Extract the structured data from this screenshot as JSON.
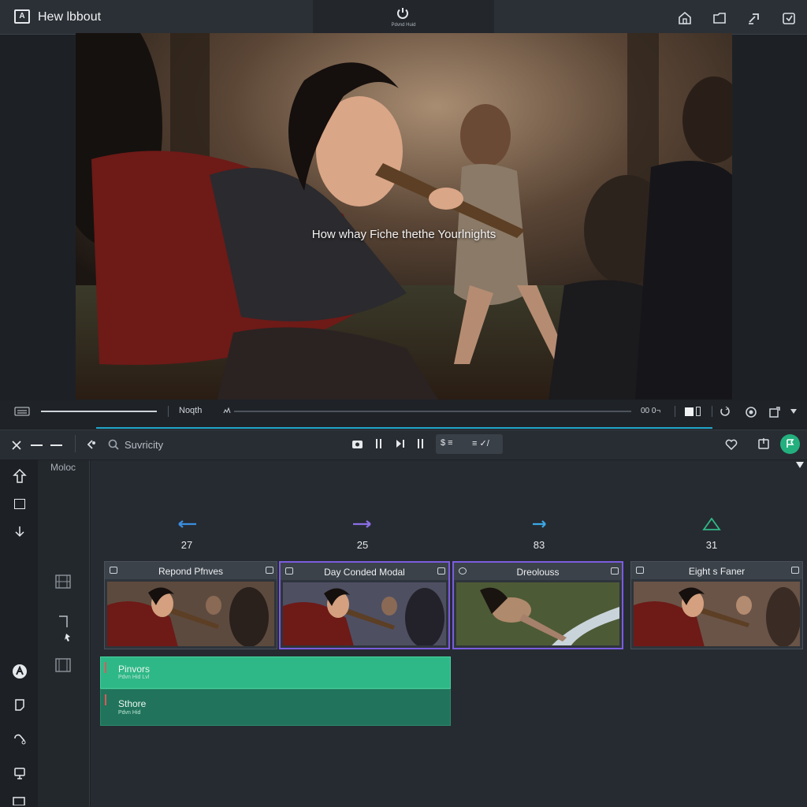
{
  "app": {
    "title": "Hew lbbout"
  },
  "titlebar": {
    "center_label": "Pdvnd Huid",
    "right_icons": [
      "home-icon",
      "folder-icon",
      "share-icon",
      "export-icon"
    ]
  },
  "preview": {
    "subtitle": "How whay Fiche thethe Yourlnights"
  },
  "transport": {
    "label": "Noqth",
    "time": "00 0¬"
  },
  "toolbar": {
    "search_placeholder": "Suvricity",
    "mid_left": "$ ≡",
    "mid_right": "≡ ✓/"
  },
  "sidebar": {
    "panel_label": "Moloc"
  },
  "timeline": {
    "markers": [
      {
        "value": "27",
        "icon": "arrow-left-icon",
        "color": "#3b8de0"
      },
      {
        "value": "25",
        "icon": "arrow-right-icon",
        "color": "#8b6fe6"
      },
      {
        "value": "83",
        "icon": "arrow-right-icon",
        "color": "#3ba8e6"
      },
      {
        "value": "31",
        "icon": "triangle-icon",
        "color": "#2fb887"
      }
    ],
    "clips": [
      {
        "title": "Repond Pfnves"
      },
      {
        "title": "Day Conded Modal"
      },
      {
        "title": "Dreolouss"
      },
      {
        "title": "Eight s Faner"
      }
    ],
    "tracks": [
      {
        "name": "Pinvors",
        "sub": "Pdvn Hid Lvl"
      },
      {
        "name": "Sthore",
        "sub": "Pdvn Hid"
      }
    ]
  },
  "colors": {
    "accent": "#23b07e",
    "selection": "#7b5ce0",
    "progress": "#21a6c9"
  }
}
